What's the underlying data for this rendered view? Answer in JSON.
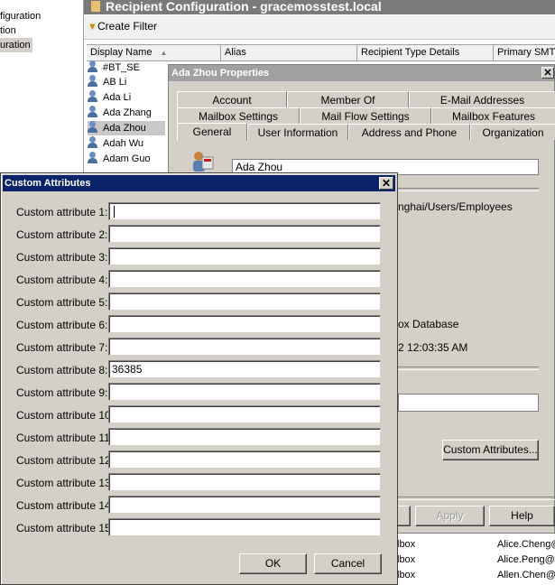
{
  "tree": {
    "items": [
      "figuration",
      "tion",
      "uration"
    ]
  },
  "main": {
    "title": "Recipient Configuration - gracemosstest.local",
    "create_filter": "Create Filter",
    "columns": [
      "Display Name",
      "Alias",
      "Recipient Type Details",
      "Primary SMTP"
    ],
    "rows": [
      "#BT_SE",
      "AB Li",
      "Ada Li",
      "Ada Zhang",
      "Ada Zhou",
      "Adah Wu",
      "Adam Guo"
    ],
    "selected_row": "Ada Zhou",
    "bottom_rows": [
      {
        "type": "lbox",
        "smtp": "Alice.Cheng@"
      },
      {
        "type": "lbox",
        "smtp": "Alice.Peng@c"
      },
      {
        "type": "lbox",
        "smtp": "Allen.Chen@"
      }
    ]
  },
  "props": {
    "title": "Ada Zhou Properties",
    "tabs_row1": [
      "Account",
      "Member Of",
      "E-Mail Addresses"
    ],
    "tabs_row2": [
      "Mailbox Settings",
      "Mail Flow Settings",
      "Mailbox Features"
    ],
    "tabs_row3": [
      "General",
      "User Information",
      "Address and Phone",
      "Organization"
    ],
    "active_tab": "General",
    "name_value": "Ada Zhou",
    "ou_text": "nghai/Users/Employees",
    "database_text": "ox Database",
    "modified_text": "2 12:03:35 AM",
    "custom_attributes_button": "Custom Attributes...",
    "apply_button": "Apply",
    "help_button": "Help"
  },
  "custom_attributes": {
    "title": "Custom Attributes",
    "fields": [
      {
        "label": "Custom attribute 1:",
        "value": ""
      },
      {
        "label": "Custom attribute 2:",
        "value": ""
      },
      {
        "label": "Custom attribute 3:",
        "value": ""
      },
      {
        "label": "Custom attribute 4:",
        "value": ""
      },
      {
        "label": "Custom attribute 5:",
        "value": ""
      },
      {
        "label": "Custom attribute 6:",
        "value": ""
      },
      {
        "label": "Custom attribute 7:",
        "value": ""
      },
      {
        "label": "Custom attribute 8:",
        "value": "36385"
      },
      {
        "label": "Custom attribute 9:",
        "value": ""
      },
      {
        "label": "Custom attribute 10:",
        "value": ""
      },
      {
        "label": "Custom attribute 11:",
        "value": ""
      },
      {
        "label": "Custom attribute 12:",
        "value": ""
      },
      {
        "label": "Custom attribute 13:",
        "value": ""
      },
      {
        "label": "Custom attribute 14:",
        "value": ""
      },
      {
        "label": "Custom attribute 15:",
        "value": ""
      }
    ],
    "ok_button": "OK",
    "cancel_button": "Cancel"
  }
}
